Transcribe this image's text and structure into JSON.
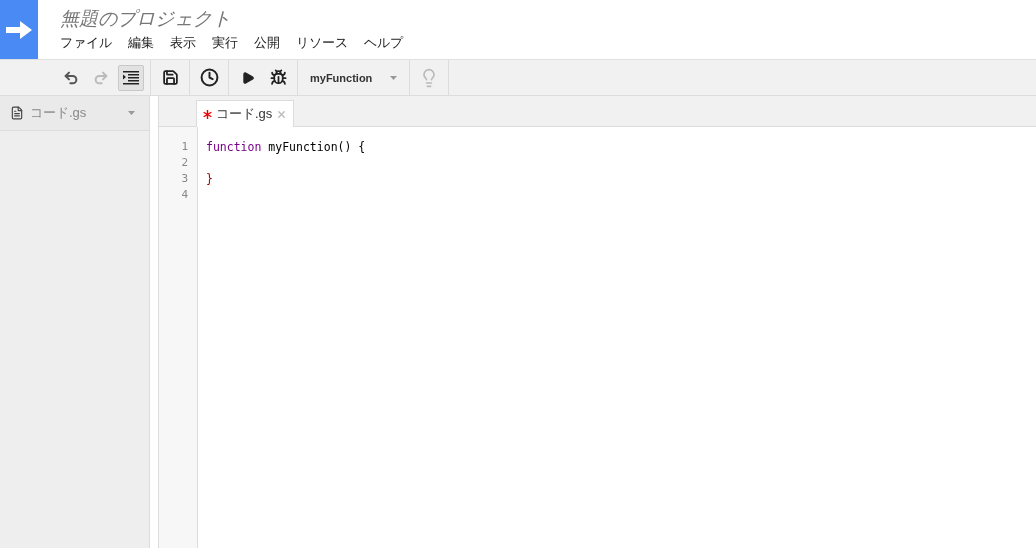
{
  "project": {
    "title": "無題のプロジェクト"
  },
  "menu": [
    {
      "label": "ファイル"
    },
    {
      "label": "編集"
    },
    {
      "label": "表示"
    },
    {
      "label": "実行"
    },
    {
      "label": "公開"
    },
    {
      "label": "リソース"
    },
    {
      "label": "ヘルプ"
    }
  ],
  "toolbar": {
    "undo": {
      "disabled": false
    },
    "redo": {
      "disabled": true
    },
    "indent": {
      "on": true
    },
    "function_select": {
      "value": "myFunction"
    },
    "hint": {
      "disabled": true
    }
  },
  "sidebar": {
    "files": [
      {
        "name": "コード.gs",
        "selected": true
      }
    ]
  },
  "editor": {
    "tabs": [
      {
        "label": "コード.gs",
        "modified": true,
        "selected": true
      }
    ],
    "lines": [
      {
        "number": "1",
        "tokens": [
          {
            "kind": "keyword",
            "text": "function"
          },
          {
            "kind": "plain",
            "text": " myFunction() {"
          }
        ]
      },
      {
        "number": "2"
      },
      {
        "number": "3",
        "tokens": [
          {
            "kind": "bracket",
            "text": "}"
          }
        ]
      },
      {
        "number": "4"
      }
    ]
  }
}
